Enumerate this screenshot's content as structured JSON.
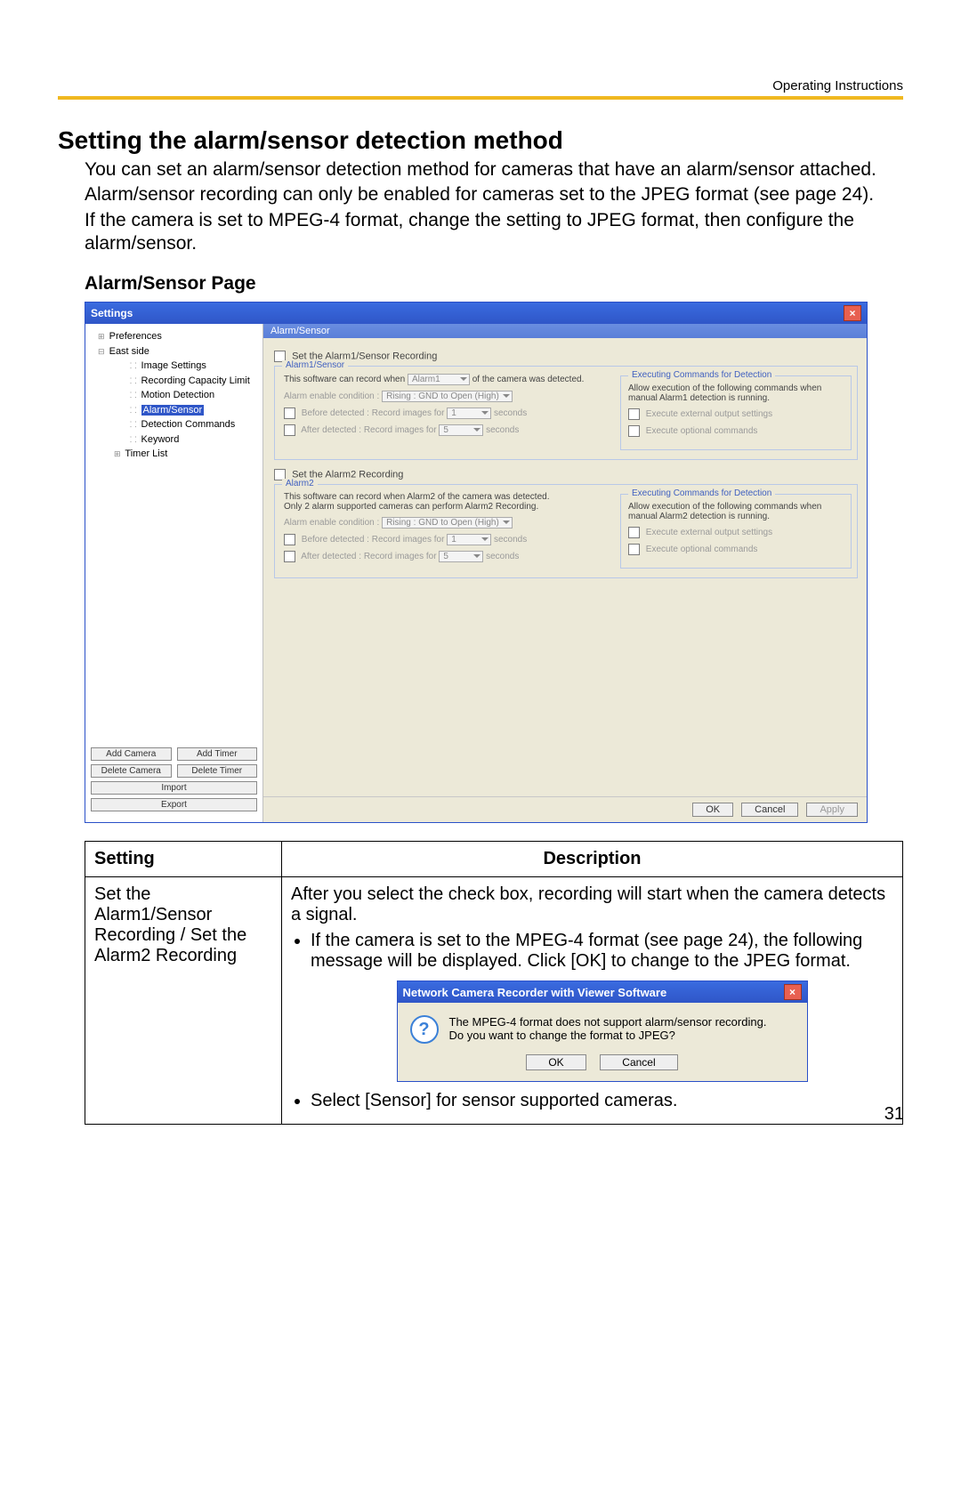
{
  "header_right": "Operating Instructions",
  "title": "Setting the alarm/sensor detection method",
  "intro": {
    "p1": "You can set an alarm/sensor detection method for cameras that have an alarm/sensor attached.",
    "p2": "Alarm/sensor recording can only be enabled for cameras set to the JPEG format (see page 24).",
    "p3": "If the camera is set to MPEG-4 format, change the setting to JPEG format, then configure the alarm/sensor."
  },
  "subhead": "Alarm/Sensor Page",
  "win": {
    "title": "Settings",
    "close": "×",
    "tree": [
      {
        "label": "Preferences",
        "lvl": 1,
        "expand": "+"
      },
      {
        "label": "East side",
        "lvl": 1,
        "expand": "-"
      },
      {
        "label": "Image Settings",
        "lvl": 3
      },
      {
        "label": "Recording Capacity Limit",
        "lvl": 3
      },
      {
        "label": "Motion Detection",
        "lvl": 3
      },
      {
        "label": "Alarm/Sensor",
        "lvl": 3,
        "selected": true
      },
      {
        "label": "Detection Commands",
        "lvl": 3
      },
      {
        "label": "Keyword",
        "lvl": 3
      },
      {
        "label": "Timer List",
        "lvl": 2,
        "expand": "+"
      }
    ],
    "side_buttons": {
      "add_camera": "Add Camera",
      "add_timer": "Add Timer",
      "delete_camera": "Delete Camera",
      "delete_timer": "Delete Timer",
      "import": "Import",
      "export": "Export"
    },
    "content_title": "Alarm/Sensor",
    "alarm1": {
      "set_chk": "Set the Alarm1/Sensor Recording",
      "legend": "Alarm1/Sensor",
      "record_when_pre": "This software can record when",
      "record_when_dd": "Alarm1",
      "record_when_post": "of the camera was detected.",
      "enable_label": "Alarm enable condition :",
      "enable_dd": "Rising : GND to Open (High)",
      "before": "Before detected : Record images for",
      "before_val": "1",
      "after": "After   detected : Record images for",
      "after_val": "5",
      "seconds": "seconds",
      "exec_legend": "Executing Commands for Detection",
      "exec_desc": "Allow execution of the following commands when manual Alarm1 detection is running.",
      "exec_c1": "Execute external output settings",
      "exec_c2": "Execute optional commands"
    },
    "alarm2": {
      "set_chk": "Set the Alarm2 Recording",
      "legend": "Alarm2",
      "record_line1": "This software can record when Alarm2 of the camera was detected.",
      "record_line2": "Only 2 alarm supported cameras can perform Alarm2 Recording.",
      "enable_label": "Alarm enable condition :",
      "enable_dd": "Rising : GND to Open (High)",
      "before": "Before detected : Record images for",
      "before_val": "1",
      "after": "After   detected : Record images for",
      "after_val": "5",
      "seconds": "seconds",
      "exec_legend": "Executing Commands for Detection",
      "exec_desc": "Allow execution of the following commands when manual Alarm2 detection is running.",
      "exec_c1": "Execute external output settings",
      "exec_c2": "Execute optional commands"
    },
    "footer": {
      "ok": "OK",
      "cancel": "Cancel",
      "apply": "Apply"
    }
  },
  "table": {
    "h1": "Setting",
    "h2": "Description",
    "r1c1": "Set the Alarm1/Sensor Recording / Set the Alarm2 Recording",
    "r1_lead": "After you select the check box, recording will start when the camera detects a signal.",
    "r1_b1": "If the camera is set to the MPEG-4 format (see page 24), the following message will be displayed. Click [OK] to change to the JPEG format.",
    "r1_b2": "Select [Sensor] for sensor supported cameras."
  },
  "dlg": {
    "title": "Network Camera Recorder with Viewer Software",
    "line1": "The MPEG-4 format does not support alarm/sensor recording.",
    "line2": "Do you want to change the format to JPEG?",
    "ok": "OK",
    "cancel": "Cancel"
  },
  "page_num": "31"
}
